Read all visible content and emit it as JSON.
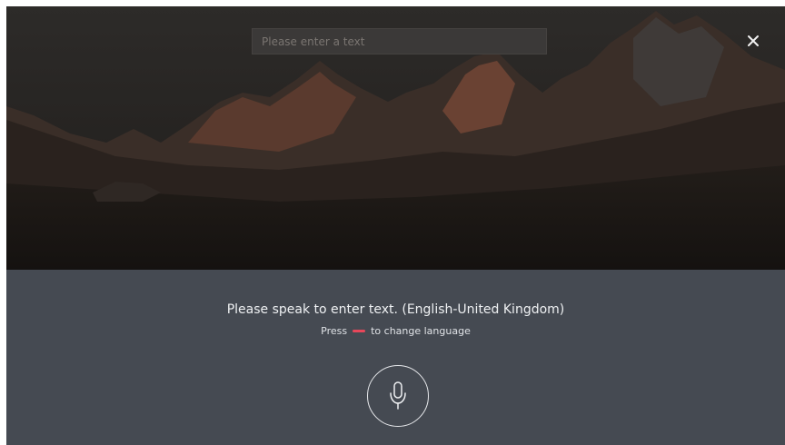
{
  "search": {
    "placeholder": "Please enter a text"
  },
  "close": {
    "icon": "close-icon"
  },
  "voice": {
    "prompt": "Please speak to enter text. (English-United Kingdom)",
    "press_label": "Press",
    "change_label": "to change language",
    "key_color": "#e8475a",
    "mic_icon": "microphone-icon"
  }
}
